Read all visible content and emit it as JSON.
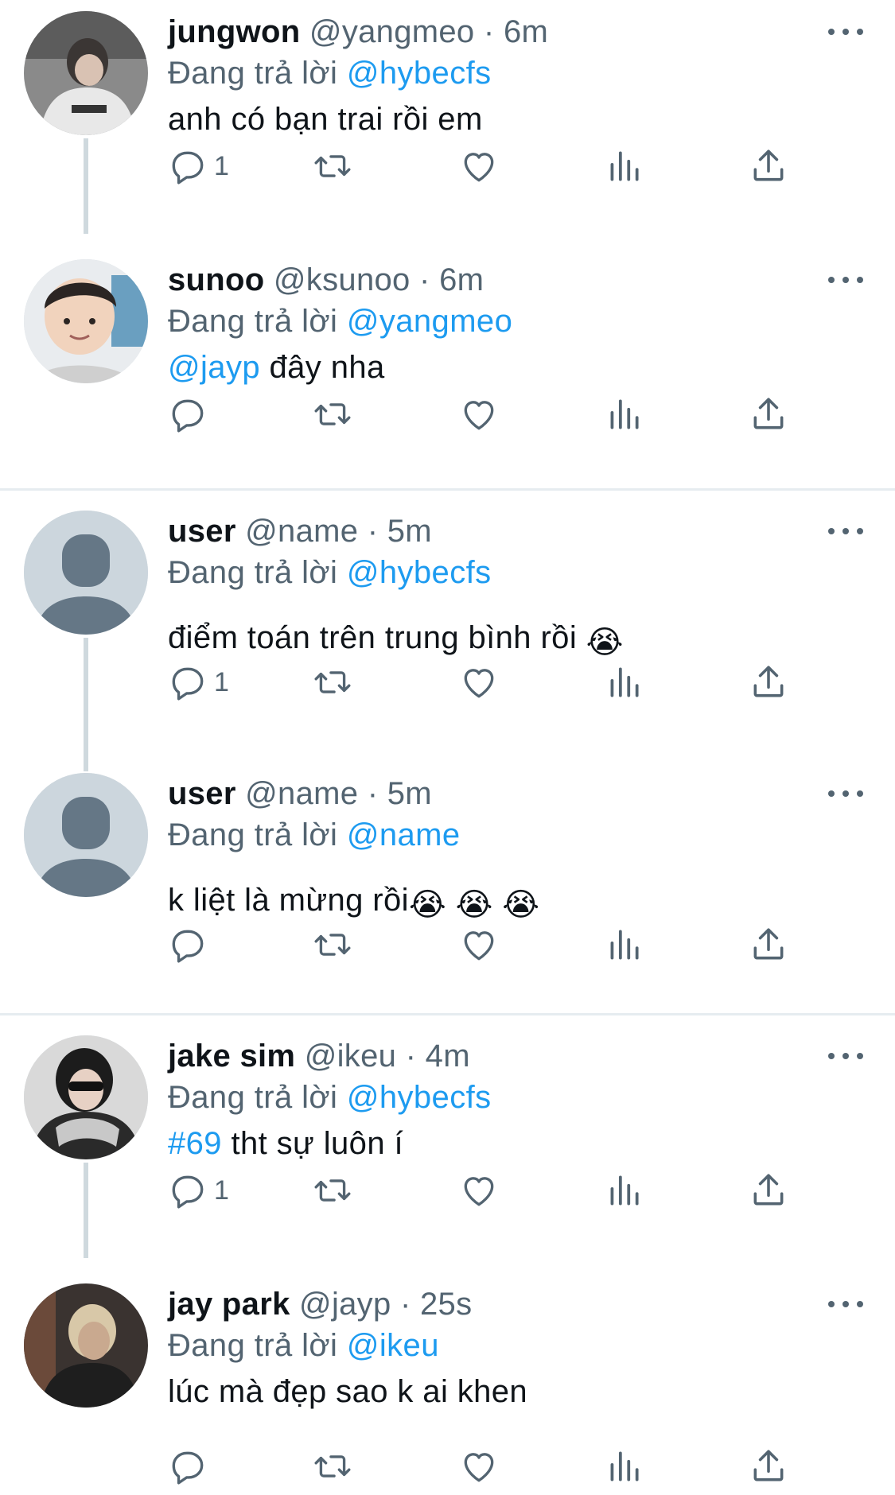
{
  "tweets": [
    {
      "display_name": "jungwon",
      "handle": "@yangmeo",
      "dot": "·",
      "time": "6m",
      "reply_prefix": "Đang trả lời",
      "reply_to": "@hybecfs",
      "text_mention": "",
      "text": "anh có bạn trai rồi em",
      "reply_count": "1",
      "avatar": "photo-person-white-hoodie"
    },
    {
      "display_name": "sunoo",
      "handle": "@ksunoo",
      "dot": "·",
      "time": "6m",
      "reply_prefix": "Đang trả lời",
      "reply_to": "@yangmeo",
      "text_mention": "@jayp",
      "text": " đây nha",
      "reply_count": "",
      "avatar": "photo-child"
    },
    {
      "display_name": "user",
      "handle": "@name",
      "dot": "·",
      "time": "5m",
      "reply_prefix": "Đang trả lời",
      "reply_to": "@hybecfs",
      "text_mention": "",
      "text": "điểm toán trên trung bình rồi ",
      "emoji": "😭",
      "reply_count": "1",
      "avatar": "default-avatar"
    },
    {
      "display_name": "user",
      "handle": "@name",
      "dot": "·",
      "time": "5m",
      "reply_prefix": "Đang trả lời",
      "reply_to": "@name",
      "text_mention": "",
      "text": "k liệt là mừng rồi",
      "emoji": "😭 😭 😭",
      "reply_count": "",
      "avatar": "default-avatar"
    },
    {
      "display_name": "jake sim",
      "handle": "@ikeu",
      "dot": "·",
      "time": "4m",
      "reply_prefix": "Đang trả lời",
      "reply_to": "@hybecfs",
      "text_mention": "#69",
      "text": " tht sự luôn í",
      "reply_count": "1",
      "avatar": "photo-person-sunglasses"
    },
    {
      "display_name": "jay park",
      "handle": "@jayp",
      "dot": "·",
      "time": "25s",
      "reply_prefix": "Đang trả lời",
      "reply_to": "@ikeu",
      "text_mention": "",
      "text": "lúc mà đẹp sao k ai khen",
      "reply_count": "",
      "avatar": "photo-person-night"
    }
  ],
  "icons": {
    "reply": "reply-icon",
    "retweet": "retweet-icon",
    "like": "heart-icon",
    "views": "stats-icon",
    "share": "share-icon",
    "more": "more-icon"
  },
  "colors": {
    "mention": "#1d9bf0",
    "secondary_text": "#536471",
    "thread_line": "#cfd9de",
    "divider": "#e6ecf0"
  }
}
